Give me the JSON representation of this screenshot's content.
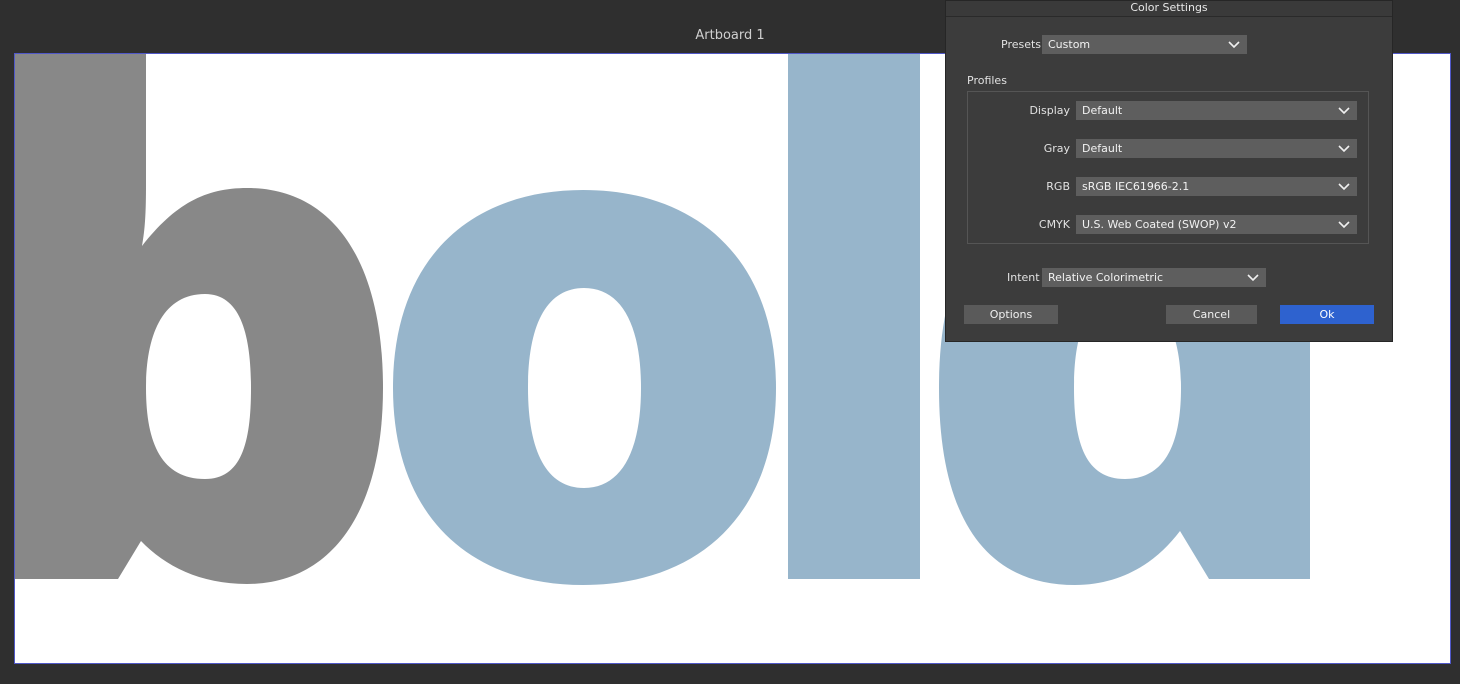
{
  "artboard": {
    "title": "Artboard 1",
    "text": "bold",
    "colors": {
      "b": "#888888",
      "old": "#97b5cb",
      "background": "#ffffff",
      "border": "#5058c8"
    }
  },
  "dialog": {
    "title": "Color Settings",
    "presets": {
      "label": "Presets",
      "value": "Custom"
    },
    "profiles_label": "Profiles",
    "profiles": [
      {
        "label": "Display",
        "value": "Default"
      },
      {
        "label": "Gray",
        "value": "Default"
      },
      {
        "label": "RGB",
        "value": "sRGB IEC61966-2.1"
      },
      {
        "label": "CMYK",
        "value": "U.S. Web Coated (SWOP) v2"
      }
    ],
    "intent": {
      "label": "Intent",
      "value": "Relative Colorimetric"
    },
    "buttons": {
      "options": "Options",
      "cancel": "Cancel",
      "ok": "Ok"
    },
    "accent": "#2e62cf"
  }
}
